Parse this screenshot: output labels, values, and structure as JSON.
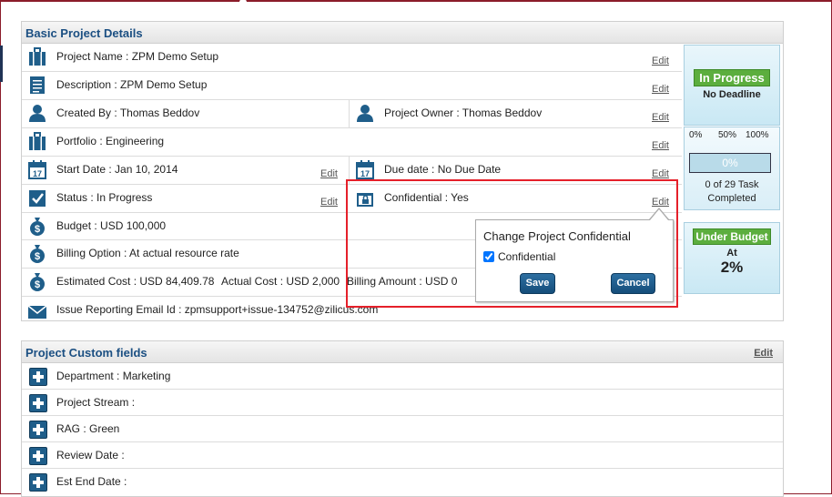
{
  "basic": {
    "title": "Basic Project Details",
    "project_name": "Project Name : ZPM Demo Setup",
    "description": "Description : ZPM Demo Setup",
    "created_by": "Created By : Thomas Beddov",
    "project_owner": "Project Owner : Thomas Beddov",
    "portfolio": "Portfolio : Engineering",
    "start_date": "Start Date : Jan 10, 2014",
    "due_date": "Due date : No Due Date",
    "status": "Status : In Progress",
    "confidential": "Confidential : Yes",
    "budget": "Budget : USD 100,000",
    "billing_option": "Billing Option : At actual resource rate",
    "estimated_cost": "Estimated Cost : USD 84,409.78",
    "actual_cost": "Actual Cost : USD 2,000",
    "billing_amount": "Billing Amount : USD 0",
    "issue_email": "Issue Reporting Email Id : zpmsupport+issue-134752@zilicus.com",
    "edit_label": "Edit"
  },
  "side": {
    "status_badge": "In Progress",
    "deadline": "No Deadline",
    "progress_labels": [
      "0%",
      "50%",
      "100%"
    ],
    "progress_value": "0%",
    "progress_fraction": 0,
    "tasks_line1": "0 of 29 Task",
    "tasks_line2": "Completed",
    "budget_badge": "Under Budget",
    "at_label": "At",
    "budget_pct": "2%"
  },
  "popup": {
    "title": "Change Project Confidential",
    "checkbox_label": "Confidential",
    "checked": true,
    "save": "Save",
    "cancel": "Cancel"
  },
  "custom": {
    "title": "Project Custom fields",
    "edit_label": "Edit",
    "fields": [
      "Department : Marketing",
      "Project Stream :",
      "RAG : Green",
      "Review Date :",
      "Est End Date :"
    ]
  },
  "colors": {
    "accent_blue": "#1b4f82",
    "badge_green": "#5cae3e",
    "highlight_red": "#e5202a"
  }
}
